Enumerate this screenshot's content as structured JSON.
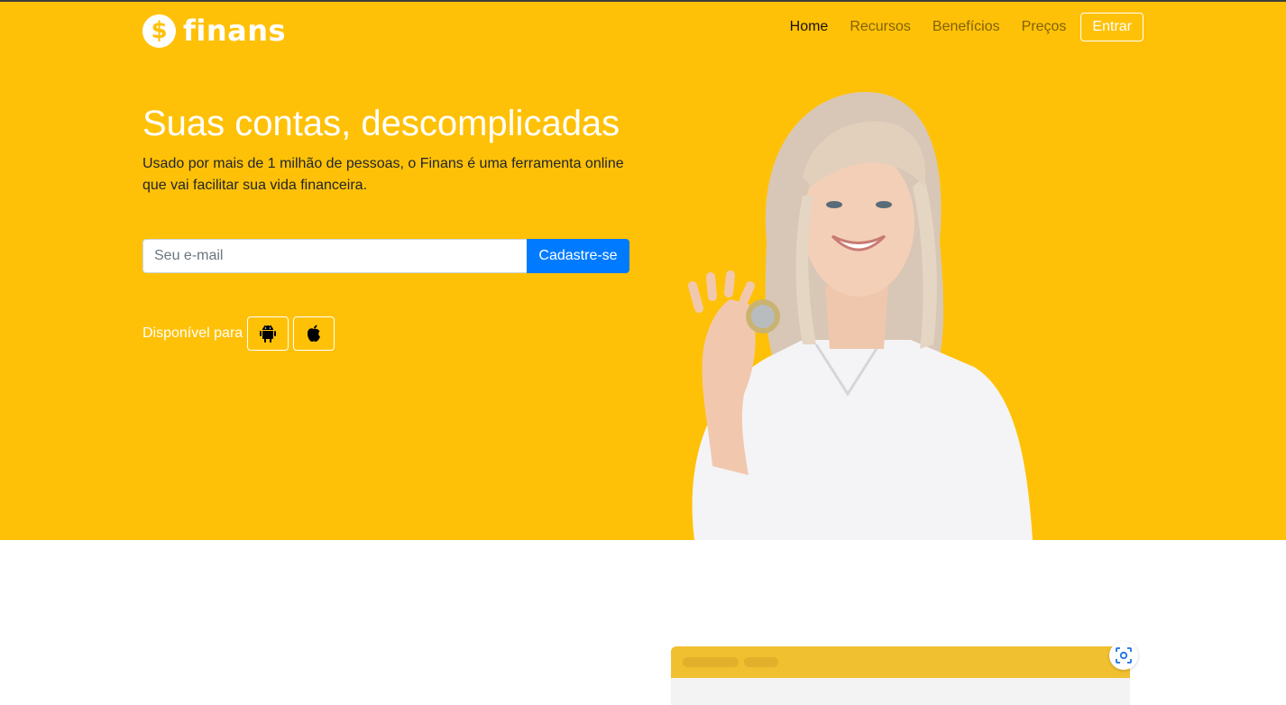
{
  "brand": {
    "name": "finans",
    "mark": "$",
    "accent": "#ffc107"
  },
  "nav": {
    "items": [
      {
        "label": "Home"
      },
      {
        "label": "Recursos"
      },
      {
        "label": "Benefícios"
      },
      {
        "label": "Preços"
      }
    ],
    "login_label": "Entrar"
  },
  "hero": {
    "title": "Suas contas, descomplicadas",
    "lead": "Usado por mais de 1 milhão de pessoas, o Finans é uma ferramenta online que vai facilitar sua vida financeira.",
    "email_placeholder": "Seu e-mail",
    "signup_label": "Cadastre-se",
    "available_label": "Disponível para",
    "stores": [
      {
        "icon": "android-icon"
      },
      {
        "icon": "apple-icon"
      }
    ]
  },
  "colors": {
    "hero_bg": "#ffc107",
    "primary": "#007bff"
  }
}
